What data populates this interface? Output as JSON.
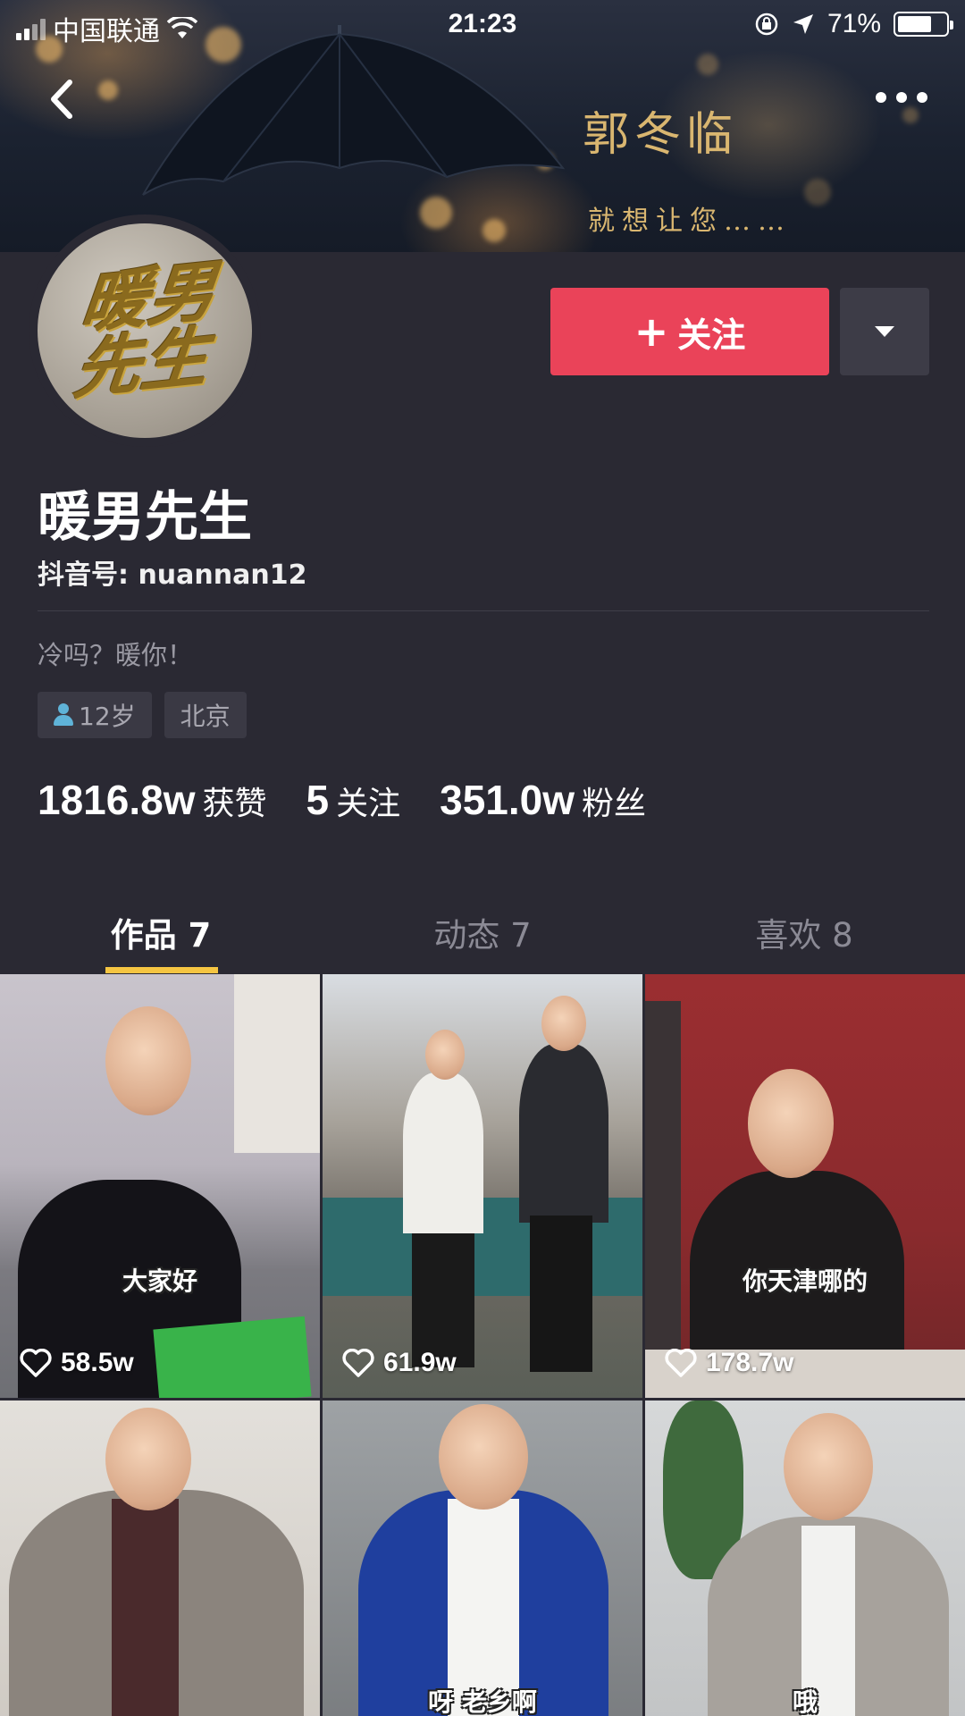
{
  "status_bar": {
    "carrier": "中国联通",
    "time": "21:23",
    "battery": "71%",
    "battery_level": 0.71
  },
  "banner": {
    "line1": "郭冬临",
    "line2": "就想让您……"
  },
  "avatar": {
    "logo_text": "暖男先生"
  },
  "actions": {
    "follow_label": "关注"
  },
  "profile": {
    "name": "暖男先生",
    "douyin_id": "抖音号: nuannan12",
    "bio": "冷吗？暖你！",
    "tags": [
      "12岁",
      "北京"
    ]
  },
  "stats": [
    {
      "value": "1816.8w",
      "label": "获赞"
    },
    {
      "value": "5",
      "label": "关注"
    },
    {
      "value": "351.0w",
      "label": "粉丝"
    }
  ],
  "tabs": [
    {
      "label": "作品 7",
      "active": true
    },
    {
      "label": "动态 7",
      "active": false
    },
    {
      "label": "喜欢 8",
      "active": false
    }
  ],
  "videos": [
    {
      "caption": "大家好",
      "likes": "58.5w"
    },
    {
      "caption": "",
      "likes": "61.9w"
    },
    {
      "caption": "你天津哪的",
      "likes": "178.7w"
    },
    {
      "caption": "",
      "likes": ""
    },
    {
      "caption": "呀 老乡啊",
      "likes": ""
    },
    {
      "caption": "哦",
      "likes": ""
    }
  ],
  "icons": {
    "back": "back-arrow-icon",
    "more": "more-dots-icon",
    "plus": "plus-icon",
    "dropdown": "caret-down-icon",
    "gender": "person-icon",
    "like": "heart-icon",
    "wifi": "wifi-icon",
    "location": "location-arrow-icon",
    "rotation_lock": "rotation-lock-icon"
  },
  "colors": {
    "background": "#2a2933",
    "follow_button": "#ea4359",
    "tab_indicator": "#f5c542",
    "banner_text": "#d9b670"
  }
}
